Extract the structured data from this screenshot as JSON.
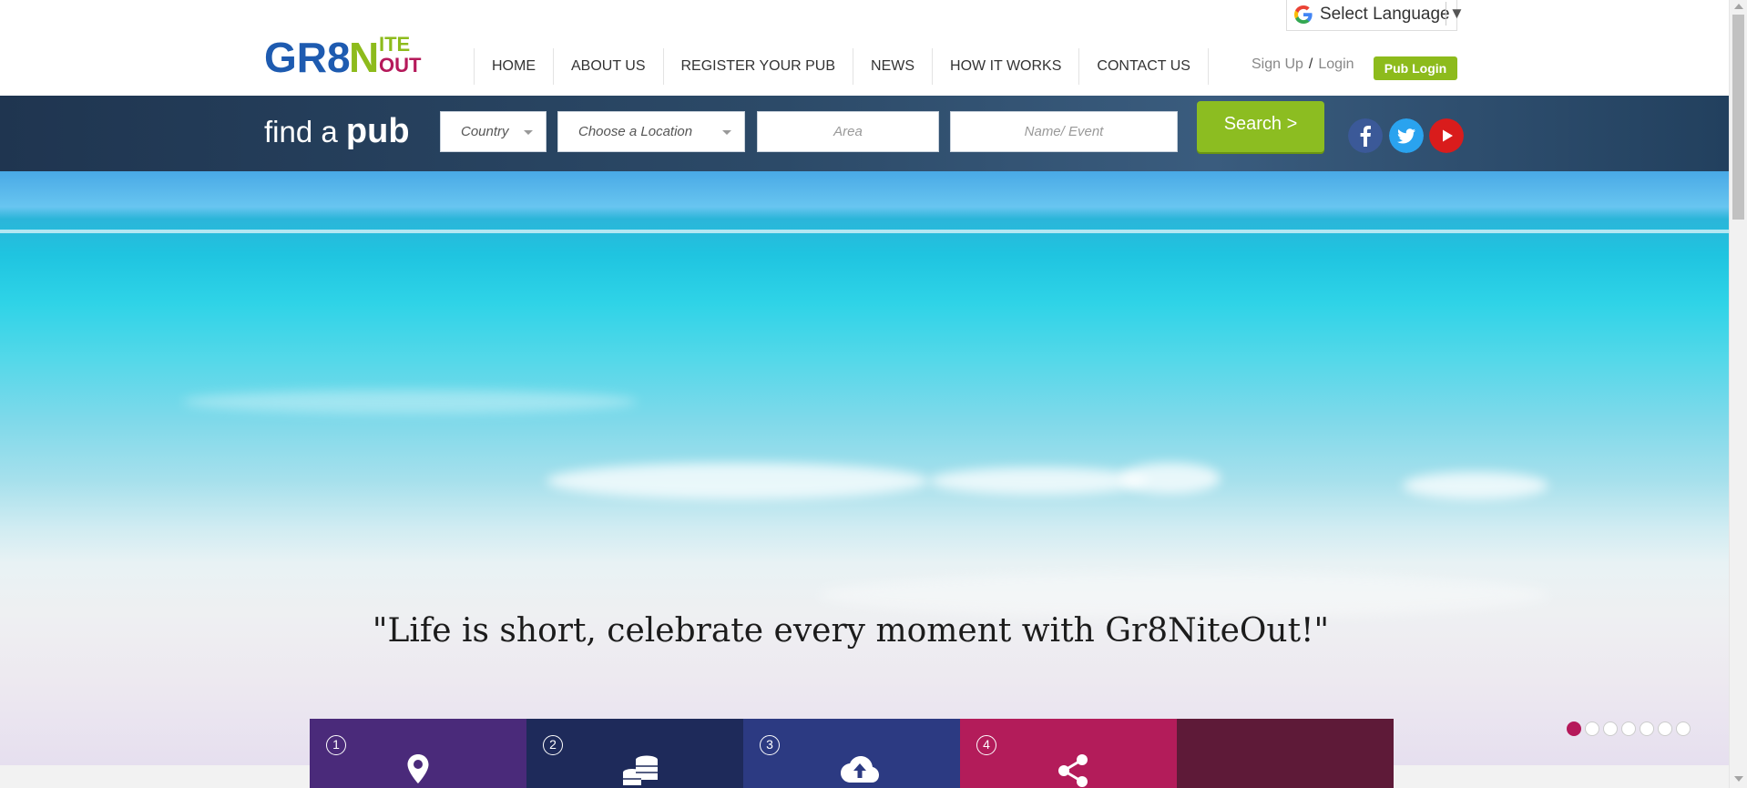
{
  "brand": {
    "logo_top": "GR8",
    "logo_n": "N",
    "logo_ite": "ITE",
    "logo_out": "OUT",
    "colors": {
      "blue": "#1e5bb0",
      "green": "#8dbb1c",
      "magenta": "#b5195a"
    }
  },
  "language": {
    "label": "Select Language",
    "icon": "google-g-icon",
    "arrow": "▼"
  },
  "nav": {
    "items": [
      {
        "label": "HOME"
      },
      {
        "label": "ABOUT US"
      },
      {
        "label": "REGISTER YOUR PUB"
      },
      {
        "label": "NEWS"
      },
      {
        "label": "HOW IT WORKS"
      },
      {
        "label": "CONTACT US"
      }
    ]
  },
  "auth": {
    "signup": "Sign Up",
    "slash": "/",
    "login": "Login",
    "pub_login": "Pub Login"
  },
  "finder": {
    "title_prefix": "find a",
    "title_bold": "pub",
    "country": "Country",
    "location": "Choose a Location",
    "area_placeholder": "Area",
    "name_placeholder": "Name/ Event",
    "search": "Search >",
    "social": [
      "facebook-icon",
      "twitter-icon",
      "youtube-icon"
    ]
  },
  "hero": {
    "quote": "\"Life is short, celebrate every moment with Gr8NiteOut!\"",
    "slides": 7,
    "active_slide": 1
  },
  "tiles": [
    {
      "number": "1",
      "icon": "map-pin-icon",
      "color": "#4a2a7a"
    },
    {
      "number": "2",
      "icon": "coins-icon",
      "color": "#1e2a5a"
    },
    {
      "number": "3",
      "icon": "cloud-upload-icon",
      "color": "#2c3a82"
    },
    {
      "number": "4",
      "icon": "share-icon",
      "color": "#b31c5a"
    },
    {
      "number": "",
      "icon": "",
      "color": "#5e1a38"
    }
  ]
}
